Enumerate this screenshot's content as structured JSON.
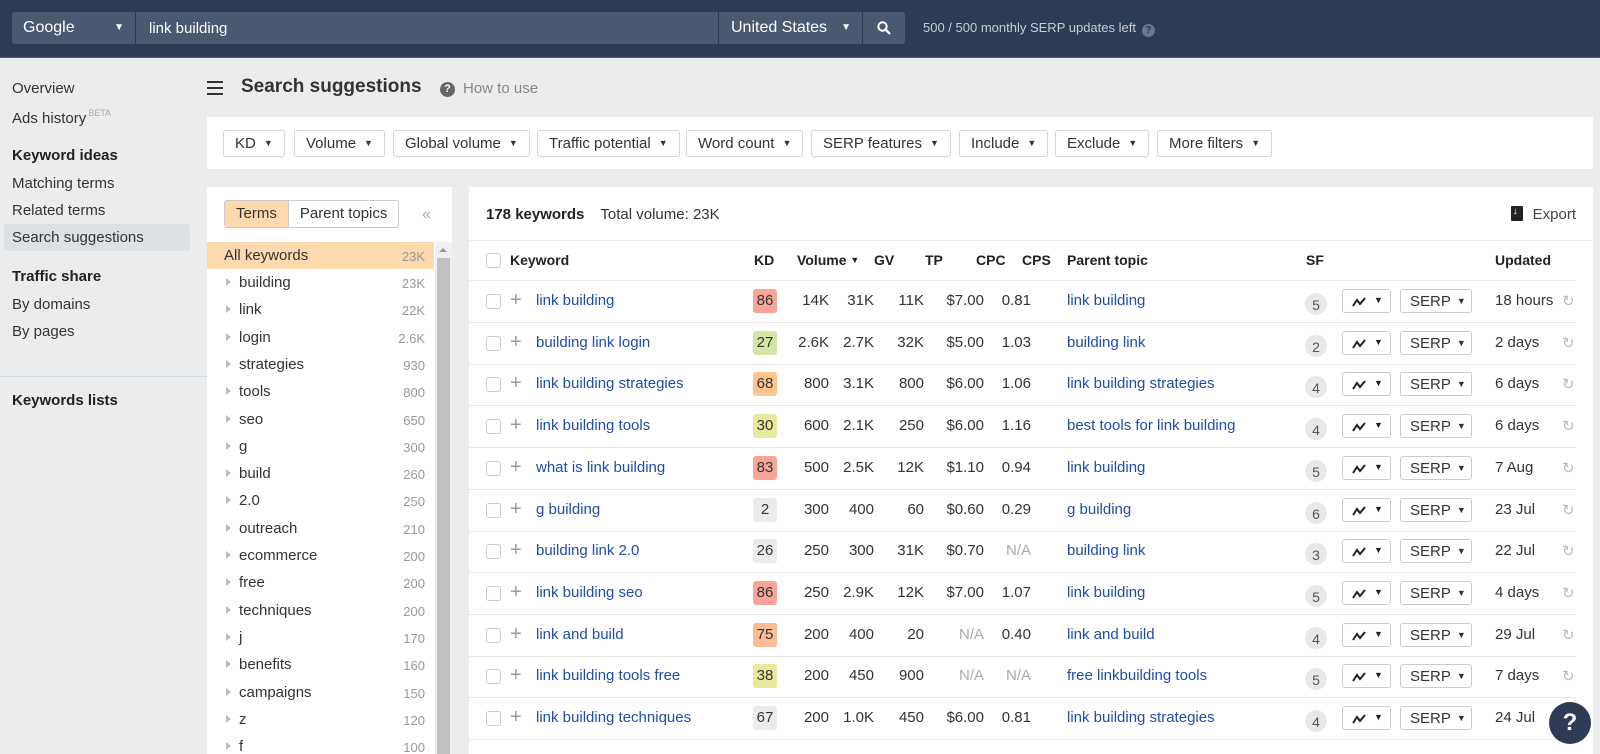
{
  "topbar": {
    "engine": "Google",
    "query": "link building",
    "country": "United States",
    "serp_updates": "500 / 500 monthly SERP updates left"
  },
  "nav": {
    "overview": "Overview",
    "ads_history": "Ads history",
    "beta": "BETA",
    "keyword_ideas": "Keyword ideas",
    "matching_terms": "Matching terms",
    "related_terms": "Related terms",
    "search_suggestions": "Search suggestions",
    "traffic_share": "Traffic share",
    "by_domains": "By domains",
    "by_pages": "By pages",
    "keywords_lists": "Keywords lists"
  },
  "header": {
    "title": "Search suggestions",
    "how_to_use": "How to use"
  },
  "filters": [
    "KD",
    "Volume",
    "Global volume",
    "Traffic potential",
    "Word count",
    "SERP features",
    "Include",
    "Exclude",
    "More filters"
  ],
  "terms_panel": {
    "tab_terms": "Terms",
    "tab_parent_topics": "Parent topics",
    "all_label": "All keywords",
    "all_count": "23K",
    "items": [
      {
        "name": "building",
        "count": "23K"
      },
      {
        "name": "link",
        "count": "22K"
      },
      {
        "name": "login",
        "count": "2.6K"
      },
      {
        "name": "strategies",
        "count": "930"
      },
      {
        "name": "tools",
        "count": "800"
      },
      {
        "name": "seo",
        "count": "650"
      },
      {
        "name": "g",
        "count": "300"
      },
      {
        "name": "build",
        "count": "260"
      },
      {
        "name": "2.0",
        "count": "250"
      },
      {
        "name": "outreach",
        "count": "210"
      },
      {
        "name": "ecommerce",
        "count": "200"
      },
      {
        "name": "free",
        "count": "200"
      },
      {
        "name": "techniques",
        "count": "200"
      },
      {
        "name": "j",
        "count": "170"
      },
      {
        "name": "benefits",
        "count": "160"
      },
      {
        "name": "campaigns",
        "count": "150"
      },
      {
        "name": "z",
        "count": "120"
      },
      {
        "name": "f",
        "count": "100"
      }
    ]
  },
  "table": {
    "keyword_count": "178 keywords",
    "total_volume": "Total volume: 23K",
    "export_label": "Export",
    "headers": {
      "keyword": "Keyword",
      "kd": "KD",
      "volume": "Volume",
      "gv": "GV",
      "tp": "TP",
      "cpc": "CPC",
      "cps": "CPS",
      "parent_topic": "Parent topic",
      "sf": "SF",
      "updated": "Updated"
    },
    "serp_label": "SERP",
    "kd_colors": {
      "red": "#f8a598",
      "orange": "#fdc58d",
      "lightorange": "#fdbb96",
      "yellow": "#e8e79a",
      "green": "#d3e6a6",
      "grey": "#ebebeb"
    },
    "rows": [
      {
        "keyword": "link building",
        "kd": "86",
        "kd_color": "red",
        "volume": "14K",
        "gv": "31K",
        "tp": "11K",
        "cpc": "$7.00",
        "cps": "0.81",
        "parent_topic": "link building",
        "sf": "5",
        "updated": "18 hours"
      },
      {
        "keyword": "building link login",
        "kd": "27",
        "kd_color": "green",
        "volume": "2.6K",
        "gv": "2.7K",
        "tp": "32K",
        "cpc": "$5.00",
        "cps": "1.03",
        "parent_topic": "building link",
        "sf": "2",
        "updated": "2 days"
      },
      {
        "keyword": "link building strategies",
        "kd": "68",
        "kd_color": "orange",
        "volume": "800",
        "gv": "3.1K",
        "tp": "800",
        "cpc": "$6.00",
        "cps": "1.06",
        "parent_topic": "link building strategies",
        "sf": "4",
        "updated": "6 days"
      },
      {
        "keyword": "link building tools",
        "kd": "30",
        "kd_color": "yellow",
        "volume": "600",
        "gv": "2.1K",
        "tp": "250",
        "cpc": "$6.00",
        "cps": "1.16",
        "parent_topic": "best tools for link building",
        "sf": "4",
        "updated": "6 days"
      },
      {
        "keyword": "what is link building",
        "kd": "83",
        "kd_color": "red",
        "volume": "500",
        "gv": "2.5K",
        "tp": "12K",
        "cpc": "$1.10",
        "cps": "0.94",
        "parent_topic": "link building",
        "sf": "5",
        "updated": "7 Aug"
      },
      {
        "keyword": "g building",
        "kd": "2",
        "kd_color": "grey",
        "volume": "300",
        "gv": "400",
        "tp": "60",
        "cpc": "$0.60",
        "cps": "0.29",
        "parent_topic": "g building",
        "sf": "6",
        "updated": "23 Jul"
      },
      {
        "keyword": "building link 2.0",
        "kd": "26",
        "kd_color": "grey",
        "volume": "250",
        "gv": "300",
        "tp": "31K",
        "cpc": "$0.70",
        "cps": "N/A",
        "parent_topic": "building link",
        "sf": "3",
        "updated": "22 Jul"
      },
      {
        "keyword": "link building seo",
        "kd": "86",
        "kd_color": "red",
        "volume": "250",
        "gv": "2.9K",
        "tp": "12K",
        "cpc": "$7.00",
        "cps": "1.07",
        "parent_topic": "link building",
        "sf": "5",
        "updated": "4 days"
      },
      {
        "keyword": "link and build",
        "kd": "75",
        "kd_color": "lightorange",
        "volume": "200",
        "gv": "400",
        "tp": "20",
        "cpc": "N/A",
        "cps": "0.40",
        "parent_topic": "link and build",
        "sf": "4",
        "updated": "29 Jul"
      },
      {
        "keyword": "link building tools free",
        "kd": "38",
        "kd_color": "yellow",
        "volume": "200",
        "gv": "450",
        "tp": "900",
        "cpc": "N/A",
        "cps": "N/A",
        "parent_topic": "free linkbuilding tools",
        "sf": "5",
        "updated": "7 days"
      },
      {
        "keyword": "link building techniques",
        "kd": "67",
        "kd_color": "grey",
        "volume": "200",
        "gv": "1.0K",
        "tp": "450",
        "cpc": "$6.00",
        "cps": "0.81",
        "parent_topic": "link building strategies",
        "sf": "4",
        "updated": "24 Jul"
      }
    ]
  },
  "help_label": "?"
}
